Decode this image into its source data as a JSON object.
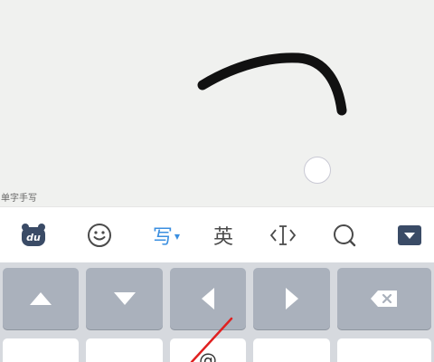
{
  "handwriting": {
    "mode_label": "单字手写"
  },
  "toolbar": {
    "logo_icon": "du-bear-logo-icon",
    "logo_text": "du",
    "emoji_icon": "smiley-icon",
    "handwrite_label": "写",
    "english_label": "英",
    "cursor_icon": "text-cursor-icon",
    "search_icon": "search-icon",
    "hide_icon": "keyboard-hide-icon"
  },
  "keyboard": {
    "keys_row1": [
      {
        "name": "up-arrow-key",
        "icon": "triangle-up-icon"
      },
      {
        "name": "down-arrow-key",
        "icon": "triangle-down-icon"
      },
      {
        "name": "left-arrow-key",
        "icon": "triangle-left-icon"
      },
      {
        "name": "right-arrow-key",
        "icon": "triangle-right-icon"
      },
      {
        "name": "backspace-key",
        "icon": "backspace-icon"
      }
    ],
    "keys_row2": [
      "",
      "",
      "@",
      "",
      ""
    ]
  },
  "colors": {
    "accent": "#3b8fe0",
    "key_gray": "#aab1bc",
    "annotation_red": "#e02020"
  }
}
